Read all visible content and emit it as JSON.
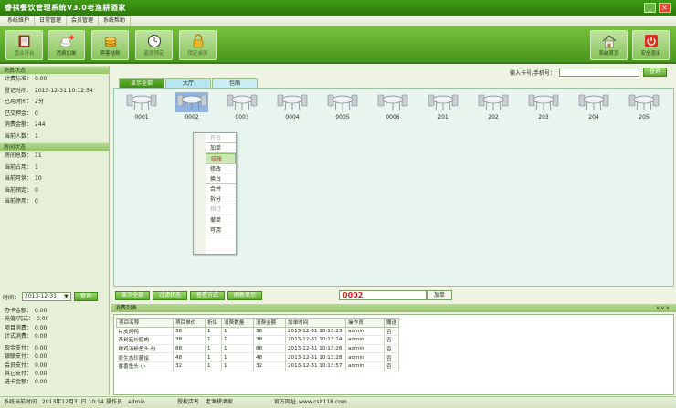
{
  "window": {
    "title": "睿祺餐饮管理系统V3.0老渔耕酒家",
    "min": "_",
    "close": "×"
  },
  "menu": [
    "系统维护",
    "日常管理",
    "会员管理",
    "系统帮助"
  ],
  "toolbar": [
    {
      "label": "营业开台",
      "icon": "notebook-icon"
    },
    {
      "label": "消费加单",
      "icon": "cup-plus-icon"
    },
    {
      "label": "宾客结账",
      "icon": "coins-icon"
    },
    {
      "label": "宴席预定",
      "icon": "clock-icon"
    },
    {
      "label": "锁定桌面",
      "icon": "lock-icon"
    },
    {
      "label": "系统首页",
      "icon": "home-icon"
    },
    {
      "label": "安全退出",
      "icon": "power-icon"
    }
  ],
  "consume_status": {
    "header": "消费状态",
    "rows": [
      {
        "k": "计费标准：",
        "v": "0.00"
      },
      {
        "k": "登记时间：",
        "v": "2013-12-31 10:12:54"
      },
      {
        "k": "已用时间：",
        "v": "2分"
      },
      {
        "k": "已交押金：",
        "v": "0"
      },
      {
        "k": "消费金额：",
        "v": "244"
      },
      {
        "k": "当前人数：",
        "v": "1"
      }
    ]
  },
  "room_status": {
    "header": "房间状态",
    "rows": [
      {
        "k": "房间总数：",
        "v": "11"
      },
      {
        "k": "当前占用：",
        "v": "1"
      },
      {
        "k": "当前可供：",
        "v": "10"
      },
      {
        "k": "当前预定：",
        "v": "0"
      },
      {
        "k": "当前停用：",
        "v": "0"
      }
    ]
  },
  "date_filter": {
    "label": "时间：",
    "value": "2013-12-31",
    "button": "查询"
  },
  "finance": [
    {
      "k": "办卡金额：",
      "v": "0.00"
    },
    {
      "k": "充值/冗式：",
      "v": "0.00"
    },
    {
      "k": "项目消费：",
      "v": "0.00"
    },
    {
      "k": "计式消费：",
      "v": "0.00"
    },
    {
      "k": "现金支付：",
      "v": "0.00"
    },
    {
      "k": "银联支付：",
      "v": "0.00"
    },
    {
      "k": "会员支付：",
      "v": "0.00"
    },
    {
      "k": "其它支付：",
      "v": "0.00"
    },
    {
      "k": "进卡金额：",
      "v": "0.00"
    }
  ],
  "search": {
    "label": "输入卡号/手机号：",
    "value": "",
    "button": "查询"
  },
  "tabs": [
    "显示全部",
    "大厅",
    "包厢"
  ],
  "rooms": [
    "0001",
    "0002",
    "0003",
    "0004",
    "0005",
    "0006",
    "201",
    "202",
    "203",
    "204",
    "205"
  ],
  "selected_room_index": 1,
  "context_menu": {
    "items": [
      "开台",
      "加单",
      "结账",
      "修改",
      "换台",
      "合并",
      "拆分",
      "预订",
      "撤单",
      "可用"
    ],
    "disabled": [
      0,
      7
    ],
    "highlighted": 2
  },
  "actions": [
    "显示全部",
    "过滤状态",
    "查看方式",
    "刷新显示"
  ],
  "room_input": "0002",
  "add_button": "加单",
  "consumption": {
    "header": "消费列表",
    "chevrons": "∨∨∨",
    "columns": [
      "项目名称",
      "项目单价",
      "折扣",
      "消费数量",
      "消费金额",
      "加单时间",
      "操作员",
      "赠送"
    ],
    "rows": [
      [
        "片皮烤鸭",
        "38",
        "1",
        "1",
        "38",
        "2013-12-31 10:13:23",
        "admin",
        "否"
      ],
      [
        "茶树菇炒腊肉",
        "38",
        "1",
        "1",
        "38",
        "2013-12-31 10:13:24",
        "admin",
        "否"
      ],
      [
        "嫩鸡汤粉鱼头·份",
        "88",
        "1",
        "1",
        "88",
        "2013-12-31 10:13:26",
        "admin",
        "否"
      ],
      [
        "原生态珍蘑烩",
        "48",
        "1",
        "1",
        "48",
        "2013-12-31 10:13:28",
        "admin",
        "否"
      ],
      [
        "番香鱼头·小",
        "32",
        "1",
        "1",
        "32",
        "2013-12-31 10:13:57",
        "admin",
        "否"
      ]
    ]
  },
  "statusbar": {
    "time_label": "系统当前时间",
    "time": "2013年12月31日 10:14",
    "op_label": "操作员",
    "op": "admin",
    "store_label": "授权店名",
    "store": "老渔耕酒家",
    "site_label": "官方网址",
    "site": "www.csit118.com"
  }
}
